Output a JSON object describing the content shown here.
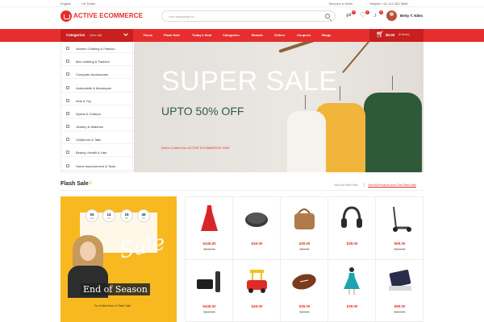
{
  "topbar": {
    "language": "English",
    "currency": "US Dollar",
    "become_seller": "Become a Seller",
    "helpline": "Helpline +01 112 352 5666"
  },
  "header": {
    "logo_text": "ACTIVE ECOMMERCE",
    "search_placeholder": "I am shopping for...",
    "compare_count": "0",
    "wishlist_count": "0",
    "notify_count": "0",
    "user_name": "Betty T. Niles"
  },
  "nav": {
    "categories_label": "Categories",
    "see_all": "(See All)",
    "items": [
      "Home",
      "Flash Sale",
      "Today's Deal",
      "Categories",
      "Brands",
      "Sellers",
      "Coupons",
      "Blogs"
    ],
    "cart_amount": "$0.00",
    "cart_items": "(0 Items)"
  },
  "categories": [
    "Women Clothing & Fashion",
    "Men clothing & Fashion",
    "Computer Accessories",
    "Automobile & Motorcycle",
    "Kids & Toy",
    "Sports & Outdoor",
    "Jewelry & Watches",
    "Cellphone & Tabs",
    "Beauty, Health & Hair",
    "Home Improvement & Tools"
  ],
  "hero": {
    "title": "SUPER SALE",
    "subtitle": "UPTO 50% OFF",
    "note": "Demo Content for ACTIVE ECOMMERCE CMS"
  },
  "flash_sale": {
    "title": "Flash Sale",
    "view_all_flash": "View All Flash Sale",
    "view_all_products": "View All Products from This Flash Sale",
    "countdown": [
      {
        "value": "04",
        "unit": "Days"
      },
      {
        "value": "14",
        "unit": "Hrs"
      },
      {
        "value": "15",
        "unit": "Min"
      },
      {
        "value": "49",
        "unit": "Sec"
      }
    ],
    "promo_script": "Sale",
    "promo_title": "End of Season",
    "promo_note": "For limited time in Flash Sale"
  },
  "products": [
    {
      "name": "red dress",
      "price": "$449.00",
      "old": "$549.00"
    },
    {
      "name": "wireless charger",
      "price": "$49.00",
      "old": ""
    },
    {
      "name": "leather handbag",
      "price": "$39.00",
      "old": "$59.00"
    },
    {
      "name": "headphones",
      "price": "$39.00",
      "old": ""
    },
    {
      "name": "electric scooter",
      "price": "$99.00",
      "old": "$119.00"
    },
    {
      "name": "tv box",
      "price": "$449.00",
      "old": "$549.00"
    },
    {
      "name": "toy car",
      "price": "$49.00",
      "old": ""
    },
    {
      "name": "american football",
      "price": "$39.00",
      "old": "$59.00"
    },
    {
      "name": "blue dress",
      "price": "$39.00",
      "old": ""
    },
    {
      "name": "tablet",
      "price": "$99.00",
      "old": "$119.00"
    }
  ],
  "colors": {
    "brand": "#e62e2e",
    "promo": "#f7b820",
    "price": "#e62e2e"
  }
}
